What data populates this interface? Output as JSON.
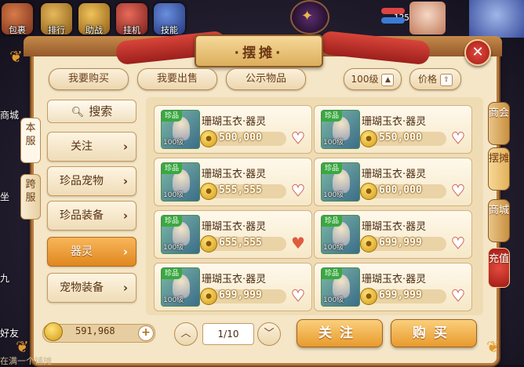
{
  "hud": {
    "icons": [
      {
        "label": "包裹",
        "icon": "bag-icon"
      },
      {
        "label": "排行",
        "icon": "ranking-icon"
      },
      {
        "label": "助战",
        "icon": "assist-icon"
      },
      {
        "label": "挂机",
        "icon": "idle-icon"
      },
      {
        "label": "技能",
        "icon": "skill-icon"
      }
    ],
    "level_number": "125",
    "side_left": [
      "商城",
      "坐",
      "九",
      "好友"
    ]
  },
  "panel": {
    "title": "·摆摊·",
    "close_label": "✕"
  },
  "top_tabs": {
    "buy": "我要购买",
    "sell": "我要出售",
    "public": "公示物品",
    "level_filter": "100级",
    "price_sort": "价格"
  },
  "left_vtabs": [
    {
      "label": "本服",
      "active": true
    },
    {
      "label": "跨服",
      "active": false
    }
  ],
  "search_label": "搜索",
  "categories": [
    {
      "label": "关注",
      "active": false
    },
    {
      "label": "珍品宠物",
      "active": false
    },
    {
      "label": "珍品装备",
      "active": false
    },
    {
      "label": "器灵",
      "active": true
    },
    {
      "label": "宠物装备",
      "active": false
    }
  ],
  "right_vtabs": [
    {
      "label": "商会",
      "active": false
    },
    {
      "label": "摆摊",
      "active": true
    },
    {
      "label": "商城",
      "active": false
    },
    {
      "label": "充值",
      "active": false
    }
  ],
  "items": [
    {
      "name": "珊瑚玉衣·器灵",
      "badge": "珍品",
      "level": "100级",
      "price": "500,000",
      "favorited": false
    },
    {
      "name": "珊瑚玉衣·器灵",
      "badge": "珍品",
      "level": "100级",
      "price": "550,000",
      "favorited": false
    },
    {
      "name": "珊瑚玉衣·器灵",
      "badge": "珍品",
      "level": "100级",
      "price": "555,555",
      "favorited": false
    },
    {
      "name": "珊瑚玉衣·器灵",
      "badge": "珍品",
      "level": "100级",
      "price": "600,000",
      "favorited": false
    },
    {
      "name": "珊瑚玉衣·器灵",
      "badge": "珍品",
      "level": "100级",
      "price": "655,555",
      "favorited": true
    },
    {
      "name": "珊瑚玉衣·器灵",
      "badge": "珍品",
      "level": "100级",
      "price": "699,999",
      "favorited": false
    },
    {
      "name": "珊瑚玉衣·器灵",
      "badge": "珍品",
      "level": "100级",
      "price": "699,999",
      "favorited": false
    },
    {
      "name": "珊瑚玉衣·器灵",
      "badge": "珍品",
      "level": "100级",
      "price": "699,999",
      "favorited": false
    }
  ],
  "footer": {
    "money": "591,968",
    "page": "1/10",
    "follow_button": "关注",
    "buy_button": "购买",
    "bottom_text": "在满一个铺摊"
  },
  "colors": {
    "accent": "#e89a2c",
    "frame": "#b67a3e",
    "panel_bg": "#f4e6c6",
    "close": "#e34b3f",
    "badge": "#3aa840"
  }
}
